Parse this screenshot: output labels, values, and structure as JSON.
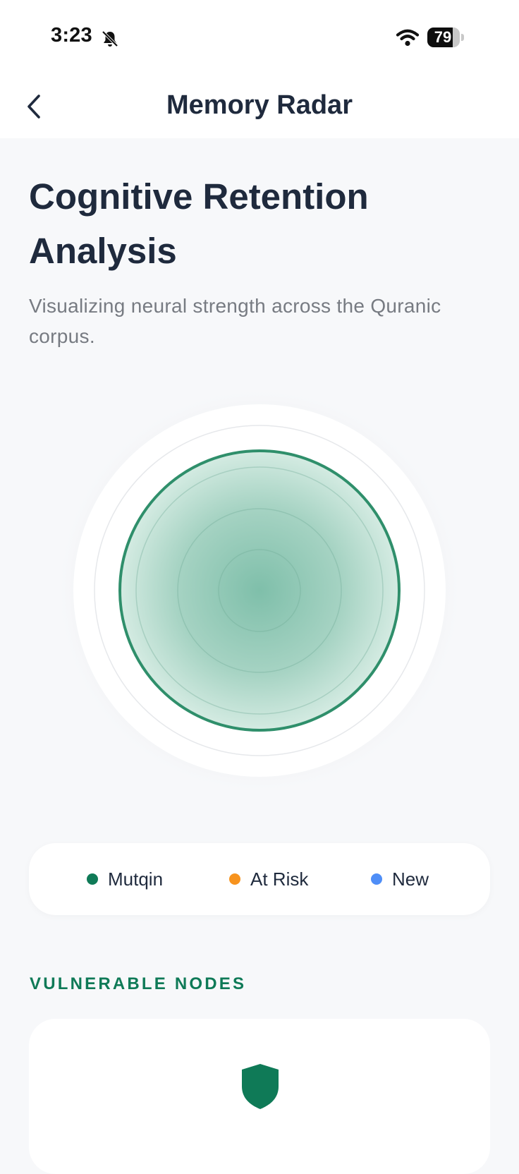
{
  "status_bar": {
    "time": "3:23",
    "battery_level": "79",
    "battery_fraction": 0.79,
    "icons": [
      "bell-off-icon",
      "wifi-icon",
      "battery-icon"
    ]
  },
  "nav": {
    "title": "Memory Radar",
    "back_icon": "chevron-left-icon"
  },
  "header": {
    "title": "Cognitive Retention Analysis",
    "subtitle": "Visualizing neural strength across the Quranic corpus."
  },
  "radar": {
    "accent_color": "#2f8f6b",
    "fill_color": "#8fc7b4"
  },
  "legend": {
    "items": [
      {
        "label": "Mutqin",
        "color": "#0f7a57"
      },
      {
        "label": "At Risk",
        "color": "#f7931e"
      },
      {
        "label": "New",
        "color": "#4f8ef7"
      }
    ]
  },
  "vulnerable_nodes": {
    "title": "VULNERABLE NODES",
    "icon": "shield-icon",
    "icon_color": "#0f7a57"
  }
}
